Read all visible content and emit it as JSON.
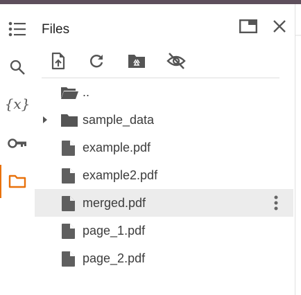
{
  "panel": {
    "title": "Files",
    "accent_color": "#e8710a",
    "rail": [
      {
        "icon": "table-of-contents-icon"
      },
      {
        "icon": "search-icon"
      },
      {
        "icon": "variables-icon",
        "label": "{x}"
      },
      {
        "icon": "key-icon"
      },
      {
        "icon": "folder-icon",
        "active": true
      }
    ],
    "header_buttons": [
      "open-in-window-icon",
      "close-icon"
    ],
    "toolbar": [
      "upload-file-icon",
      "refresh-icon",
      "mount-drive-icon",
      "hide-hidden-files-icon"
    ]
  },
  "files": [
    {
      "name": "..",
      "type": "parent-folder"
    },
    {
      "name": "sample_data",
      "type": "folder"
    },
    {
      "name": "example.pdf",
      "type": "file"
    },
    {
      "name": "example2.pdf",
      "type": "file"
    },
    {
      "name": "merged.pdf",
      "type": "file",
      "selected": true
    },
    {
      "name": "page_1.pdf",
      "type": "file"
    },
    {
      "name": "page_2.pdf",
      "type": "file"
    }
  ]
}
